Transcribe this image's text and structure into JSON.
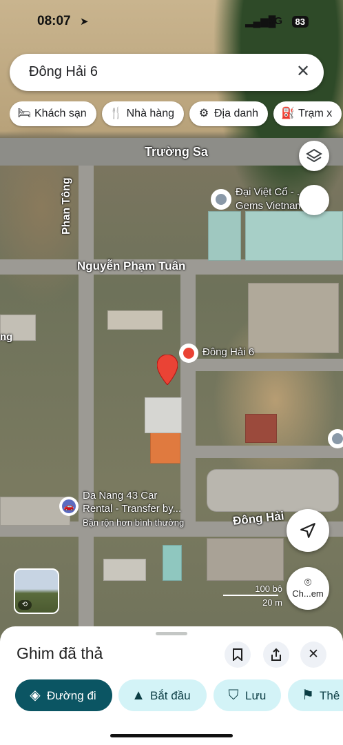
{
  "status": {
    "time": "08:07",
    "network": "5G",
    "battery": "83"
  },
  "search": {
    "query": "Đông Hải 6"
  },
  "chips": [
    {
      "icon": "bed-icon",
      "label": "Khách sạn"
    },
    {
      "icon": "restaurant-icon",
      "label": "Nhà hàng"
    },
    {
      "icon": "landmark-icon",
      "label": "Địa danh"
    },
    {
      "icon": "gas-station-icon",
      "label": "Trạm x"
    }
  ],
  "map": {
    "streets": {
      "truong_sa": "Trường Sa",
      "phan_tong": "Phan Tông",
      "nguyen_pham_tuan": "Nguyễn Phạm Tuân",
      "dong_hai": "Đông Hải"
    },
    "places": {
      "dai_viet": "Đại Việt Cổ - ...d",
      "dai_viet_2": "Gems Vietnam",
      "dong_hai_6": "Đông Hải 6",
      "car_rental_1": "Da Nang 43 Car",
      "car_rental_2": "Rental - Transfer by...",
      "car_rental_status": "Bận rộn hơn bình thường",
      "left_edge": "ng"
    },
    "scale": {
      "imperial": "100 bộ",
      "metric": "20 m"
    },
    "streetview_label": "Ch...em"
  },
  "sheet": {
    "title": "Ghim đã thả",
    "actions": [
      {
        "label": "Đường đi",
        "icon": "directions-icon"
      },
      {
        "label": "Bắt đầu",
        "icon": "navigation-arrow-icon"
      },
      {
        "label": "Lưu",
        "icon": "bookmark-icon"
      },
      {
        "label": "Thê",
        "icon": "flag-icon"
      }
    ]
  },
  "colors": {
    "primary": "#0b57d0",
    "primary_dark": "#0b5563",
    "chip_bg": "#d3f3f7",
    "pin_red": "#ea4335"
  }
}
